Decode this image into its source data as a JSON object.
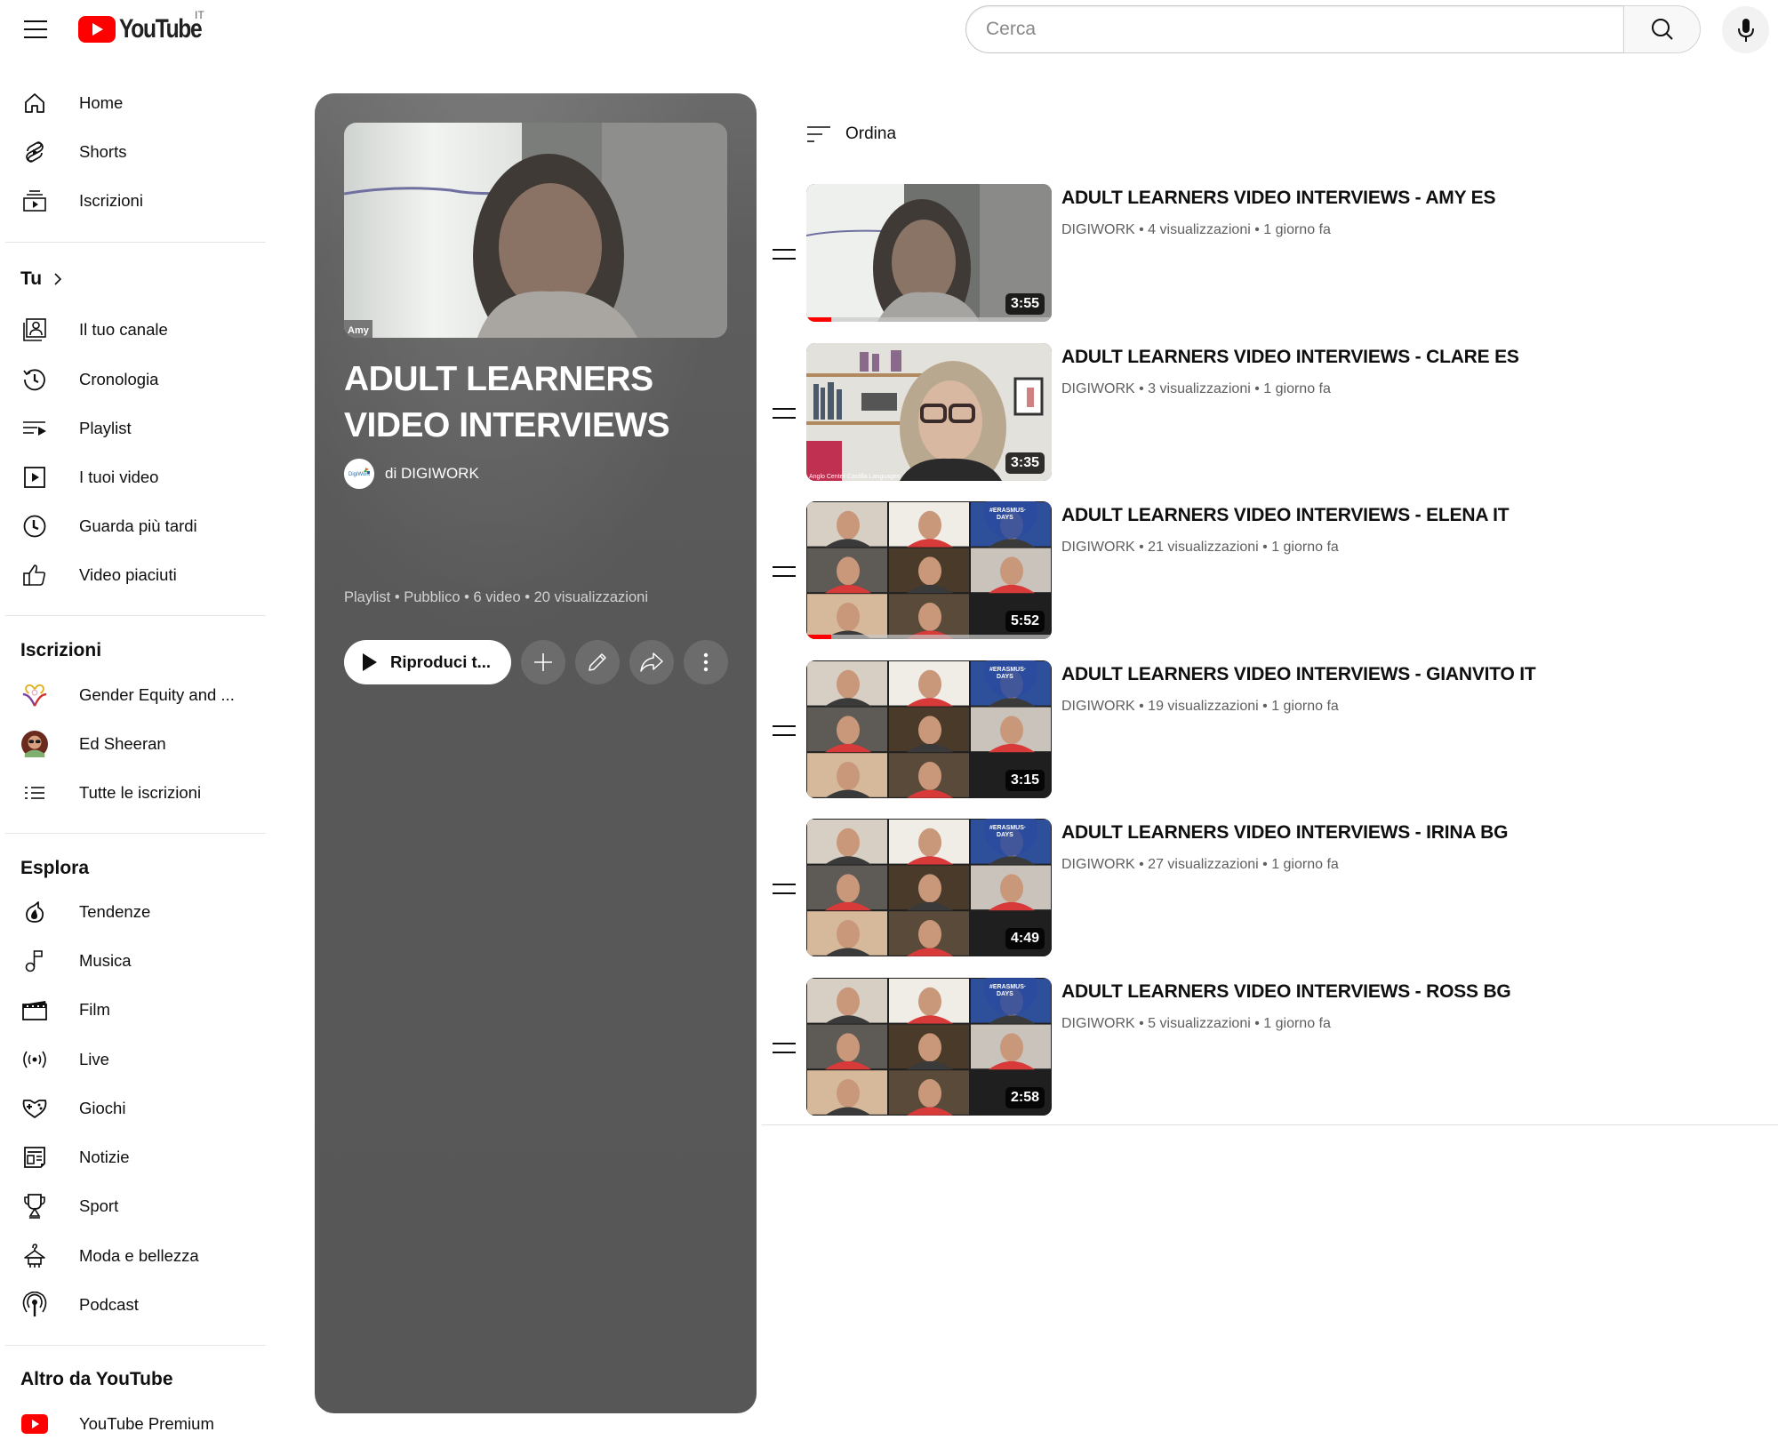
{
  "header": {
    "logo_text": "YouTube",
    "country_code": "IT",
    "search_placeholder": "Cerca",
    "search_value": "",
    "colors": {
      "brand_red": "#ff0000"
    }
  },
  "sidebar": {
    "main": [
      {
        "label": "Home",
        "icon": "home-icon"
      },
      {
        "label": "Shorts",
        "icon": "shorts-icon"
      },
      {
        "label": "Iscrizioni",
        "icon": "subscriptions-icon"
      }
    ],
    "you_header": "Tu",
    "you": [
      {
        "label": "Il tuo canale",
        "icon": "your-channel-icon"
      },
      {
        "label": "Cronologia",
        "icon": "history-icon"
      },
      {
        "label": "Playlist",
        "icon": "playlist-icon"
      },
      {
        "label": "I tuoi video",
        "icon": "your-videos-icon"
      },
      {
        "label": "Guarda più tardi",
        "icon": "watch-later-icon"
      },
      {
        "label": "Video piaciuti",
        "icon": "liked-videos-icon"
      }
    ],
    "subscriptions_header": "Iscrizioni",
    "subscriptions": [
      {
        "label": "Gender Equity and ...",
        "icon": "gender-equity-avatar"
      },
      {
        "label": "Ed Sheeran",
        "icon": "ed-sheeran-avatar"
      },
      {
        "label": "Tutte le iscrizioni",
        "icon": "all-subscriptions-icon"
      }
    ],
    "explore_header": "Esplora",
    "explore": [
      {
        "label": "Tendenze",
        "icon": "trending-icon"
      },
      {
        "label": "Musica",
        "icon": "music-icon"
      },
      {
        "label": "Film",
        "icon": "film-icon"
      },
      {
        "label": "Live",
        "icon": "live-icon"
      },
      {
        "label": "Giochi",
        "icon": "gaming-icon"
      },
      {
        "label": "Notizie",
        "icon": "news-icon"
      },
      {
        "label": "Sport",
        "icon": "sports-icon"
      },
      {
        "label": "Moda e bellezza",
        "icon": "fashion-icon"
      },
      {
        "label": "Podcast",
        "icon": "podcast-icon"
      }
    ],
    "more_header": "Altro da YouTube",
    "more": [
      {
        "label": "YouTube Premium",
        "icon": "youtube-premium-icon"
      }
    ]
  },
  "playlist": {
    "title": "ADULT LEARNERS VIDEO INTERVIEWS",
    "owner": "di DIGIWORK",
    "thumbnail_caption": "Amy",
    "meta": "Playlist • Pubblico • 6 video • 20 visualizzazioni",
    "play_all_label": "Riproduci t...",
    "actions": [
      "add-to-library",
      "edit",
      "share",
      "more"
    ]
  },
  "sort_label": "Ordina",
  "videos": [
    {
      "title": "ADULT LEARNERS VIDEO INTERVIEWS - AMY ES",
      "channel": "DIGIWORK",
      "views": "4 visualizzazioni",
      "age": "1 giorno fa",
      "duration": "3:55",
      "watched_progress": 0.1,
      "thumb": "single-amy"
    },
    {
      "title": "ADULT LEARNERS VIDEO INTERVIEWS - CLARE ES",
      "channel": "DIGIWORK",
      "views": "3 visualizzazioni",
      "age": "1 giorno fa",
      "duration": "3:35",
      "watched_progress": 0,
      "thumb": "single-clare",
      "thumb_caption": "Anglo Center Castilla Languages"
    },
    {
      "title": "ADULT LEARNERS VIDEO INTERVIEWS - ELENA IT",
      "channel": "DIGIWORK",
      "views": "21 visualizzazioni",
      "age": "1 giorno fa",
      "duration": "5:52",
      "watched_progress": 0.1,
      "thumb": "grid"
    },
    {
      "title": "ADULT LEARNERS VIDEO INTERVIEWS - GIANVITO IT",
      "channel": "DIGIWORK",
      "views": "19 visualizzazioni",
      "age": "1 giorno fa",
      "duration": "3:15",
      "watched_progress": 0,
      "thumb": "grid"
    },
    {
      "title": "ADULT LEARNERS VIDEO INTERVIEWS - IRINA BG",
      "channel": "DIGIWORK",
      "views": "27 visualizzazioni",
      "age": "1 giorno fa",
      "duration": "4:49",
      "watched_progress": 0,
      "thumb": "grid"
    },
    {
      "title": "ADULT LEARNERS VIDEO INTERVIEWS - ROSS BG",
      "channel": "DIGIWORK",
      "views": "5 visualizzazioni",
      "age": "1 giorno fa",
      "duration": "2:58",
      "watched_progress": 0,
      "thumb": "grid"
    }
  ]
}
